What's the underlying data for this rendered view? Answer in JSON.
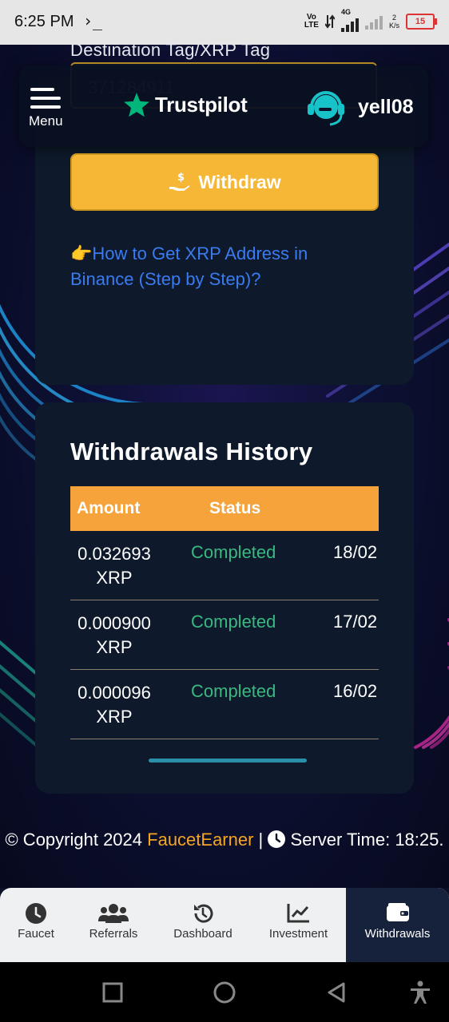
{
  "statusbar": {
    "time": "6:25 PM",
    "prompt_icon": "terminal-icon",
    "volte": "Vo\nLTE",
    "network": "4G",
    "speed": "2\nK/s",
    "battery": "15"
  },
  "form": {
    "destination_label": "Destination Tag/XRP Tag",
    "destination_value": "371284911",
    "withdraw_label": "Withdraw",
    "howto_emoji": "👉",
    "howto_link": "How to Get XRP Address in Binance (Step by Step)?"
  },
  "header": {
    "menu_label": "Menu",
    "trustpilot_label": "Trustpilot",
    "username": "yell08"
  },
  "history": {
    "title": "Withdrawals History",
    "columns": [
      "Amount",
      "Status"
    ],
    "rows": [
      {
        "amount": "0.032693 XRP",
        "status": "Completed",
        "date": "18/02"
      },
      {
        "amount": "0.000900 XRP",
        "status": "Completed",
        "date": "17/02"
      },
      {
        "amount": "0.000096 XRP",
        "status": "Completed",
        "date": "16/02"
      }
    ]
  },
  "footer": {
    "copyright_prefix": "© Copyright 2024 ",
    "brand": "FaucetEarner",
    "separator": " | ",
    "server_time_label": "Server Time: 18:25."
  },
  "nav": {
    "items": [
      {
        "label": "Faucet",
        "icon": "clock-icon"
      },
      {
        "label": "Referrals",
        "icon": "users-icon"
      },
      {
        "label": "Dashboard",
        "icon": "history-icon"
      },
      {
        "label": "Investment",
        "icon": "chart-line-icon"
      },
      {
        "label": "Withdrawals",
        "icon": "wallet-icon"
      }
    ],
    "active": "Withdrawals"
  },
  "colors": {
    "accent": "#f5b735",
    "table_header": "#f5a33a",
    "status_completed": "#39b880",
    "link": "#3a7bf0",
    "brand": "#f5a623",
    "trustpilot_star": "#00b67a",
    "support_icon": "#17c3c9"
  }
}
